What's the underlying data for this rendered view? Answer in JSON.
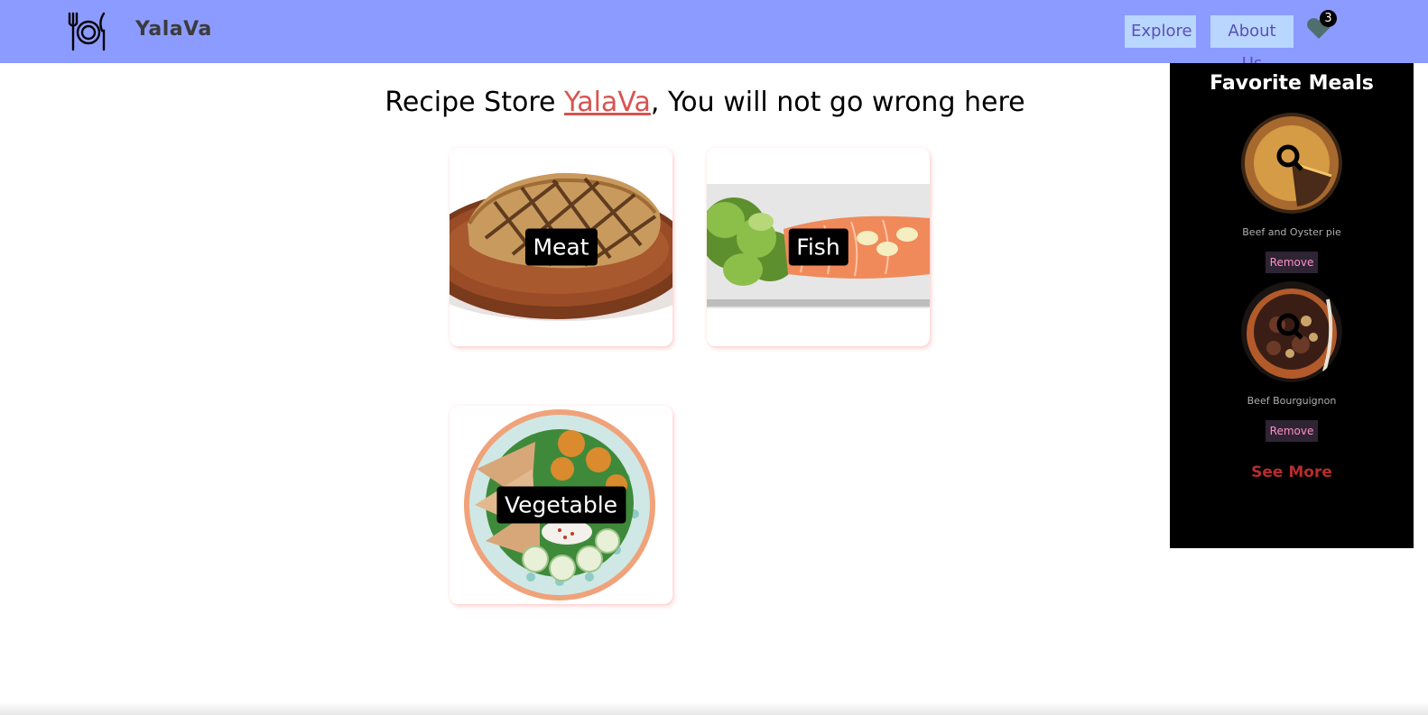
{
  "nav": {
    "brand": "YalaVa",
    "explore_label": "Explore",
    "about_label": "About Us",
    "favorites_count": "3"
  },
  "headline": {
    "prefix": "Recipe Store ",
    "brand": "YalaVa",
    "suffix": ", You will not go wrong here"
  },
  "categories": [
    {
      "label": "Meat",
      "image": "grilled-steak"
    },
    {
      "label": "Fish",
      "image": "salmon-salad-plate"
    },
    {
      "label": "Vegetable",
      "image": "vegetable-bowl"
    }
  ],
  "favorites": {
    "title": "Favorite Meals",
    "items": [
      {
        "name": "Beef and Oyster pie",
        "remove_label": "Remove",
        "image": "pie"
      },
      {
        "name": "Beef Bourguignon",
        "remove_label": "Remove",
        "image": "stew-bowl"
      }
    ],
    "see_more_label": "See More"
  },
  "colors": {
    "navbar": "#8c9bff",
    "nav_button": "#b9d6ff",
    "nav_button_text": "#5a4fb8",
    "brand_link": "#d9534f",
    "heart": "#4f6e6e",
    "panel": "#000000",
    "remove_text": "#ff8fc7",
    "see_more": "#b52d2d"
  }
}
